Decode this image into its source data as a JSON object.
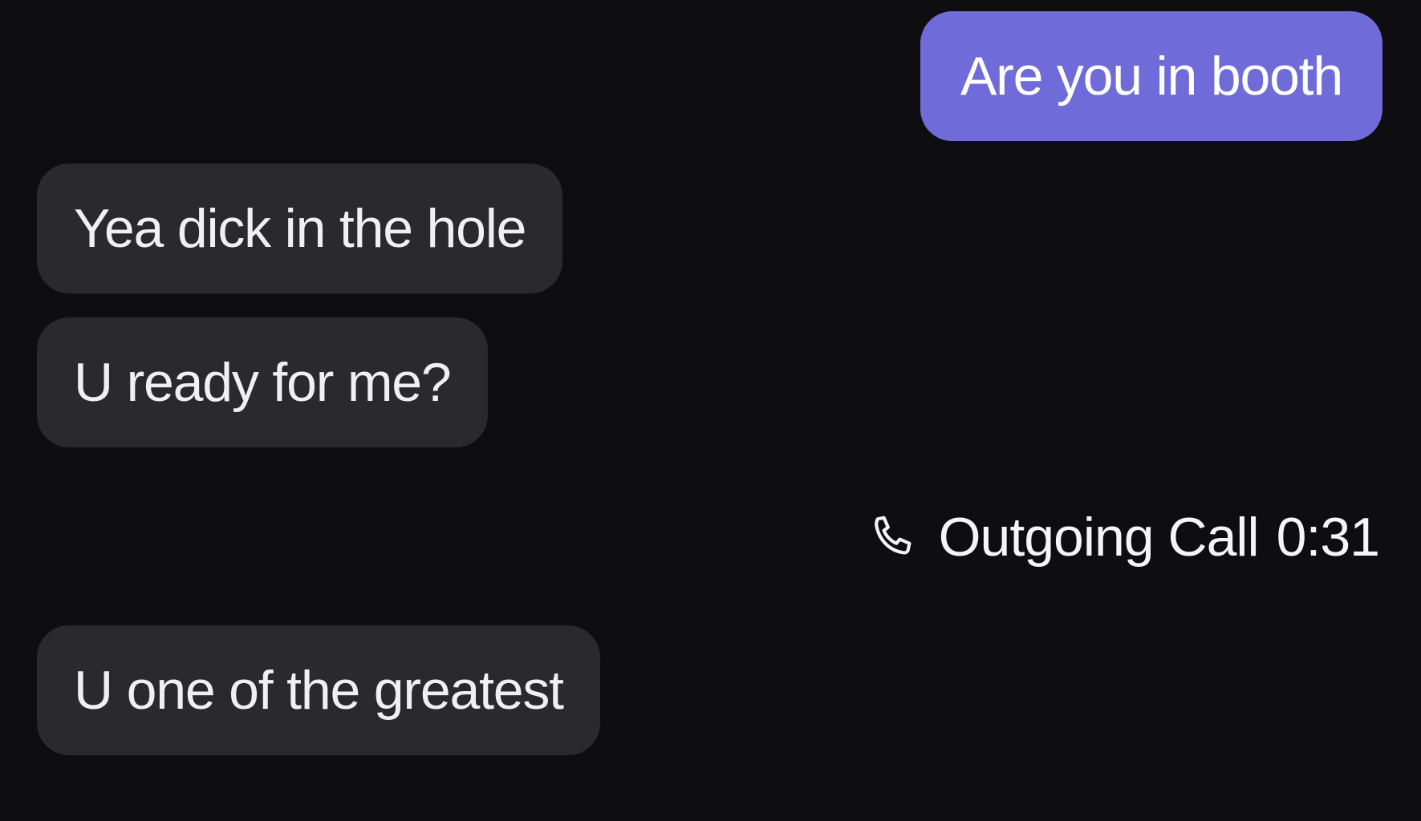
{
  "messages": [
    {
      "direction": "outgoing",
      "text": "Are you in booth"
    },
    {
      "direction": "incoming",
      "text": "Yea dick in the hole"
    },
    {
      "direction": "incoming",
      "text": "U ready for me?"
    },
    {
      "direction": "incoming",
      "text": "U one of the greatest"
    }
  ],
  "call_event": {
    "icon": "phone-icon",
    "label": "Outgoing Call",
    "duration": "0:31"
  },
  "colors": {
    "background": "#0e0e10",
    "outgoing_bubble": "#6f6bd8",
    "incoming_bubble": "#2a2a2e",
    "text": "#f5f5f7"
  }
}
